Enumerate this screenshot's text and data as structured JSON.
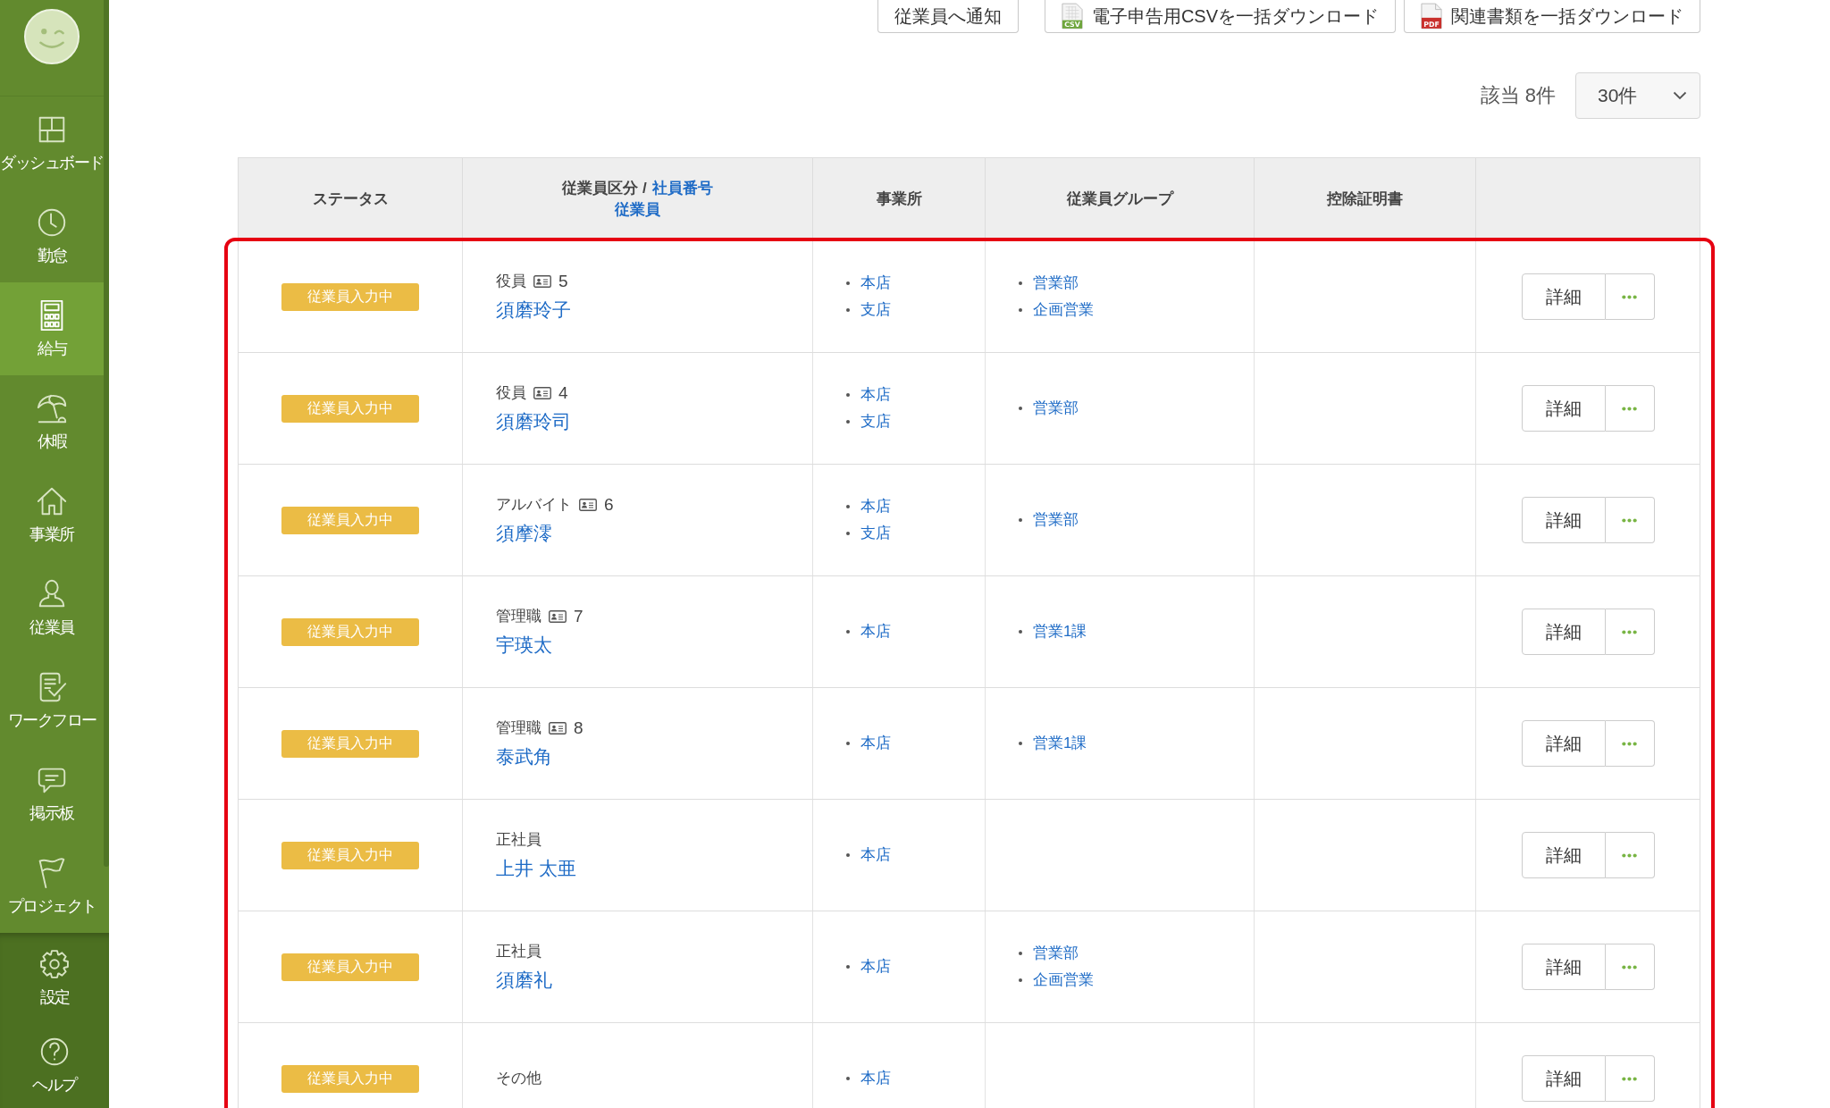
{
  "sidebar": {
    "items": [
      {
        "label": "ダッシュボード",
        "selected": false
      },
      {
        "label": "勤怠",
        "selected": false
      },
      {
        "label": "給与",
        "selected": true
      },
      {
        "label": "休暇",
        "selected": false
      },
      {
        "label": "事業所",
        "selected": false
      },
      {
        "label": "従業員",
        "selected": false
      },
      {
        "label": "ワークフロー",
        "selected": false
      },
      {
        "label": "掲示板",
        "selected": false
      },
      {
        "label": "プロジェクト",
        "selected": false
      }
    ],
    "footer_items": [
      {
        "label": "設定",
        "selected": false
      },
      {
        "label": "ヘルプ",
        "selected": false
      }
    ]
  },
  "toolbar": {
    "buttons": [
      {
        "label": "従業員へ通知",
        "kind": "plain"
      },
      {
        "label": "電子申告用CSVを一括ダウンロード",
        "kind": "csv",
        "icon_text": "CSV"
      },
      {
        "label": "関連書類を一括ダウンロード",
        "kind": "pdf",
        "icon_text": "PDF"
      }
    ]
  },
  "result_count": "該当 8件",
  "page_size": {
    "value": "30件"
  },
  "table": {
    "highlighted": true,
    "columns": [
      {
        "label": "ステータス"
      },
      {
        "label": "従業員区分 /",
        "links": [
          "社員番号",
          "従業員"
        ]
      },
      {
        "label": "事業所"
      },
      {
        "label": "従業員グループ"
      },
      {
        "label": "控除証明書"
      }
    ],
    "rows": [
      {
        "status": "従業員入力中",
        "category": "役員",
        "employee_number": "5",
        "name": "須磨玲子",
        "offices": [
          "本店",
          "支店"
        ],
        "groups": [
          "営業部",
          "企画営業"
        ],
        "detail_button": "詳細"
      },
      {
        "status": "従業員入力中",
        "category": "役員",
        "employee_number": "4",
        "name": "須磨玲司",
        "offices": [
          "本店",
          "支店"
        ],
        "groups": [
          "営業部"
        ],
        "detail_button": "詳細"
      },
      {
        "status": "従業員入力中",
        "category": "アルバイト",
        "employee_number": "6",
        "name": "須摩澪",
        "offices": [
          "本店",
          "支店"
        ],
        "groups": [
          "営業部"
        ],
        "detail_button": "詳細"
      },
      {
        "status": "従業員入力中",
        "category": "管理職",
        "employee_number": "7",
        "name": "宇瑛太",
        "offices": [
          "本店"
        ],
        "groups": [
          "営業1課"
        ],
        "detail_button": "詳細"
      },
      {
        "status": "従業員入力中",
        "category": "管理職",
        "employee_number": "8",
        "name": "泰武角",
        "offices": [
          "本店"
        ],
        "groups": [
          "営業1課"
        ],
        "detail_button": "詳細"
      },
      {
        "status": "従業員入力中",
        "category": "正社員",
        "name": "上井 太亜",
        "offices": [
          "本店"
        ],
        "detail_button": "詳細"
      },
      {
        "status": "従業員入力中",
        "category": "正社員",
        "name": "須磨礼",
        "offices": [
          "本店"
        ],
        "groups": [
          "営業部",
          "企画営業"
        ],
        "detail_button": "詳細"
      },
      {
        "status": "従業員入力中",
        "category": "その他",
        "offices": [
          "本店"
        ],
        "detail_button": "詳細"
      }
    ]
  }
}
